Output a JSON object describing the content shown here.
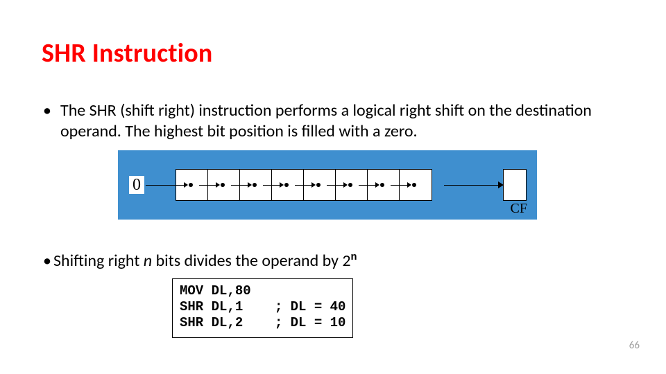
{
  "title": "SHR Instruction",
  "bullet1": "The SHR (shift right) instruction performs a logical right shift on the destination operand. The highest bit position is filled with a zero.",
  "diagram": {
    "zero_label": "0",
    "cf_label": "CF"
  },
  "bullet2": {
    "prefix": "Shifting right ",
    "n": "n",
    "mid": " bits divides the operand by 2",
    "exp": "n"
  },
  "code": {
    "l1": "MOV DL,80",
    "l2": "SHR DL,1    ; DL = 40",
    "l3": "SHR DL,2    ; DL = 10"
  },
  "page_number": "66"
}
